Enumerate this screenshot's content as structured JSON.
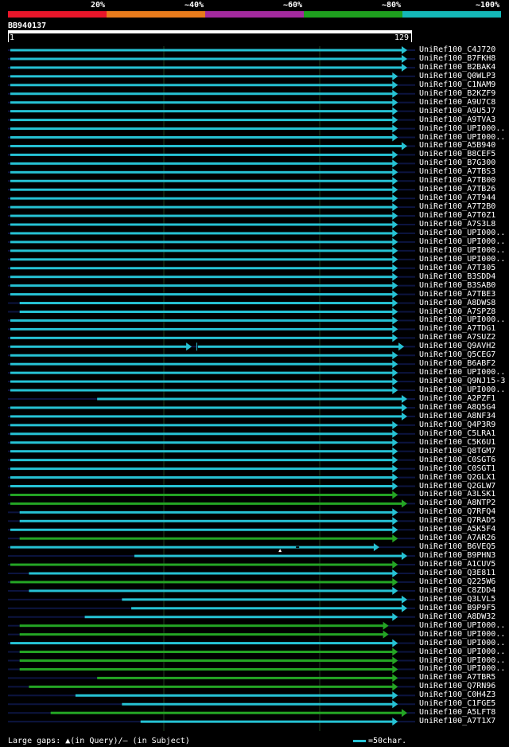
{
  "legend": {
    "segments": [
      {
        "color": "#e8162a",
        "label": "20%"
      },
      {
        "color": "#e87b1c",
        "label": "~40%"
      },
      {
        "color": "#a32a9e",
        "label": "~60%"
      },
      {
        "color": "#1ea01e",
        "label": "~80%"
      },
      {
        "color": "#14b8b8",
        "label": "~100%"
      }
    ]
  },
  "query": {
    "id": "BB940137",
    "start": "1",
    "end": "129"
  },
  "colors": {
    "cyan": "#26c2d4",
    "green": "#24a524",
    "dark": "#0c1440",
    "grid": "#1f3f1f"
  },
  "hits": [
    {
      "name": "UniRef100_C4J720",
      "s": 1,
      "e": 129,
      "c": "cyan"
    },
    {
      "name": "UniRef100_B7FKH8",
      "s": 1,
      "e": 129,
      "c": "cyan"
    },
    {
      "name": "UniRef100_B2BAK4",
      "s": 1,
      "e": 129,
      "c": "cyan"
    },
    {
      "name": "UniRef100_Q0WLP3",
      "s": 1,
      "e": 126,
      "c": "cyan"
    },
    {
      "name": "UniRef100_C1NAM9",
      "s": 1,
      "e": 126,
      "c": "cyan"
    },
    {
      "name": "UniRef100_B2KZF9",
      "s": 1,
      "e": 126,
      "c": "cyan"
    },
    {
      "name": "UniRef100_A9U7C8",
      "s": 1,
      "e": 126,
      "c": "cyan"
    },
    {
      "name": "UniRef100_A9U5J7",
      "s": 1,
      "e": 126,
      "c": "cyan"
    },
    {
      "name": "UniRef100_A9TVA3",
      "s": 1,
      "e": 126,
      "c": "cyan"
    },
    {
      "name": "UniRef100_UPI000..",
      "s": 1,
      "e": 126,
      "c": "cyan"
    },
    {
      "name": "UniRef100_UPI000..",
      "s": 1,
      "e": 126,
      "c": "cyan"
    },
    {
      "name": "UniRef100_A5B940",
      "s": 1,
      "e": 129,
      "c": "cyan"
    },
    {
      "name": "UniRef100_B8CEF5",
      "s": 1,
      "e": 126,
      "c": "cyan"
    },
    {
      "name": "UniRef100_B7G300",
      "s": 1,
      "e": 126,
      "c": "cyan"
    },
    {
      "name": "UniRef100_A7TBS3",
      "s": 1,
      "e": 126,
      "c": "cyan"
    },
    {
      "name": "UniRef100_A7TB00",
      "s": 1,
      "e": 126,
      "c": "cyan"
    },
    {
      "name": "UniRef100_A7TB26",
      "s": 1,
      "e": 126,
      "c": "cyan"
    },
    {
      "name": "UniRef100_A7T944",
      "s": 1,
      "e": 126,
      "c": "cyan"
    },
    {
      "name": "UniRef100_A7T2B0",
      "s": 1,
      "e": 126,
      "c": "cyan"
    },
    {
      "name": "UniRef100_A7T0Z1",
      "s": 1,
      "e": 126,
      "c": "cyan"
    },
    {
      "name": "UniRef100_A7S3L8",
      "s": 1,
      "e": 126,
      "c": "cyan"
    },
    {
      "name": "UniRef100_UPI000..",
      "s": 1,
      "e": 126,
      "c": "cyan"
    },
    {
      "name": "UniRef100_UPI000..",
      "s": 1,
      "e": 126,
      "c": "cyan"
    },
    {
      "name": "UniRef100_UPI000..",
      "s": 1,
      "e": 126,
      "c": "cyan"
    },
    {
      "name": "UniRef100_UPI000..",
      "s": 1,
      "e": 126,
      "c": "cyan"
    },
    {
      "name": "UniRef100_A7T305",
      "s": 1,
      "e": 126,
      "c": "cyan"
    },
    {
      "name": "UniRef100_B3SDD4",
      "s": 1,
      "e": 126,
      "c": "cyan"
    },
    {
      "name": "UniRef100_B3SAB0",
      "s": 1,
      "e": 126,
      "c": "cyan"
    },
    {
      "name": "UniRef100_A7TBE3",
      "s": 1,
      "e": 126,
      "c": "cyan"
    },
    {
      "name": "UniRef100_A8DWS8",
      "s": 4,
      "e": 126,
      "c": "cyan"
    },
    {
      "name": "UniRef100_A7SPZ8",
      "s": 4,
      "e": 126,
      "c": "cyan"
    },
    {
      "name": "UniRef100_UPI000..",
      "s": 1,
      "e": 126,
      "c": "cyan"
    },
    {
      "name": "UniRef100_A7TDG1",
      "s": 1,
      "e": 126,
      "c": "cyan"
    },
    {
      "name": "UniRef100_A7SUZ2",
      "s": 1,
      "e": 126,
      "c": "cyan"
    },
    {
      "name": "UniRef100_Q9AVH2",
      "s": 1,
      "e": 128,
      "c": "cyan",
      "gap": [
        59,
        61
      ]
    },
    {
      "name": "UniRef100_Q5CEG7",
      "s": 1,
      "e": 126,
      "c": "cyan"
    },
    {
      "name": "UniRef100_B6ABF2",
      "s": 1,
      "e": 126,
      "c": "cyan"
    },
    {
      "name": "UniRef100_UPI000..",
      "s": 1,
      "e": 126,
      "c": "cyan"
    },
    {
      "name": "UniRef100_Q9NJ15-3",
      "s": 1,
      "e": 126,
      "c": "cyan"
    },
    {
      "name": "UniRef100_UPI000..",
      "s": 1,
      "e": 126,
      "c": "cyan"
    },
    {
      "name": "UniRef100_A2PZF1",
      "s": 29,
      "e": 129,
      "c": "cyan"
    },
    {
      "name": "UniRef100_A8Q5G4",
      "s": 1,
      "e": 129,
      "c": "cyan"
    },
    {
      "name": "UniRef100_A8NF34",
      "s": 1,
      "e": 129,
      "c": "cyan"
    },
    {
      "name": "UniRef100_Q4P3R9",
      "s": 1,
      "e": 126,
      "c": "cyan"
    },
    {
      "name": "UniRef100_C5LRA1",
      "s": 1,
      "e": 126,
      "c": "cyan"
    },
    {
      "name": "UniRef100_C5K6U1",
      "s": 1,
      "e": 126,
      "c": "cyan"
    },
    {
      "name": "UniRef100_Q8TGM7",
      "s": 1,
      "e": 126,
      "c": "cyan"
    },
    {
      "name": "UniRef100_C0SGT6",
      "s": 1,
      "e": 126,
      "c": "cyan"
    },
    {
      "name": "UniRef100_C0SGT1",
      "s": 1,
      "e": 126,
      "c": "cyan"
    },
    {
      "name": "UniRef100_Q2GLX1",
      "s": 1,
      "e": 126,
      "c": "cyan"
    },
    {
      "name": "UniRef100_Q2GLW7",
      "s": 1,
      "e": 126,
      "c": "cyan"
    },
    {
      "name": "UniRef100_A3LSK1",
      "s": 1,
      "e": 126,
      "c": "green"
    },
    {
      "name": "UniRef100_A8NTP2",
      "s": 1,
      "e": 129,
      "c": "green"
    },
    {
      "name": "UniRef100_Q7RFQ4",
      "s": 4,
      "e": 126,
      "c": "cyan"
    },
    {
      "name": "UniRef100_Q7RAD5",
      "s": 4,
      "e": 126,
      "c": "cyan"
    },
    {
      "name": "UniRef100_A5K5F4",
      "s": 1,
      "e": 126,
      "c": "cyan"
    },
    {
      "name": "UniRef100_A7AR26",
      "s": 4,
      "e": 126,
      "c": "green"
    },
    {
      "name": "UniRef100_B6VEQ5",
      "s": 1,
      "e": 120,
      "c": "cyan",
      "ins": 88
    },
    {
      "name": "UniRef100_B9PHN3",
      "s": 41,
      "e": 129,
      "c": "cyan"
    },
    {
      "name": "UniRef100_A1CUV5",
      "s": 1,
      "e": 126,
      "c": "green"
    },
    {
      "name": "UniRef100_Q3E811",
      "s": 7,
      "e": 126,
      "c": "cyan"
    },
    {
      "name": "UniRef100_Q225W6",
      "s": 1,
      "e": 126,
      "c": "green"
    },
    {
      "name": "UniRef100_C8ZDD4",
      "s": 7,
      "e": 126,
      "c": "cyan"
    },
    {
      "name": "UniRef100_Q3LVL5",
      "s": 37,
      "e": 129,
      "c": "cyan"
    },
    {
      "name": "UniRef100_B9P9F5",
      "s": 40,
      "e": 129,
      "c": "cyan"
    },
    {
      "name": "UniRef100_A8DW32",
      "s": 25,
      "e": 126,
      "c": "cyan"
    },
    {
      "name": "UniRef100_UPI000..",
      "s": 4,
      "e": 123,
      "c": "green"
    },
    {
      "name": "UniRef100_UPI000..",
      "s": 4,
      "e": 123,
      "c": "green"
    },
    {
      "name": "UniRef100_UPI000..",
      "s": 1,
      "e": 126,
      "c": "cyan"
    },
    {
      "name": "UniRef100_UPI000..",
      "s": 4,
      "e": 126,
      "c": "green"
    },
    {
      "name": "UniRef100_UPI000..",
      "s": 4,
      "e": 126,
      "c": "green"
    },
    {
      "name": "UniRef100_UPI000..",
      "s": 4,
      "e": 126,
      "c": "green"
    },
    {
      "name": "UniRef100_A7TBR5",
      "s": 29,
      "e": 126,
      "c": "green"
    },
    {
      "name": "UniRef100_Q7RN96",
      "s": 7,
      "e": 126,
      "c": "green"
    },
    {
      "name": "UniRef100_C0H4Z3",
      "s": 22,
      "e": 126,
      "c": "cyan"
    },
    {
      "name": "UniRef100_C1FGE5",
      "s": 37,
      "e": 126,
      "c": "cyan"
    },
    {
      "name": "UniRef100_A5LFT8",
      "s": 14,
      "e": 129,
      "c": "green"
    },
    {
      "name": "UniRef100_A7T1X7",
      "s": 43,
      "e": 126,
      "c": "cyan"
    }
  ],
  "footer": {
    "label": "Large gaps: ▲(in Query)/— (in Subject)",
    "scale": "=50char."
  }
}
